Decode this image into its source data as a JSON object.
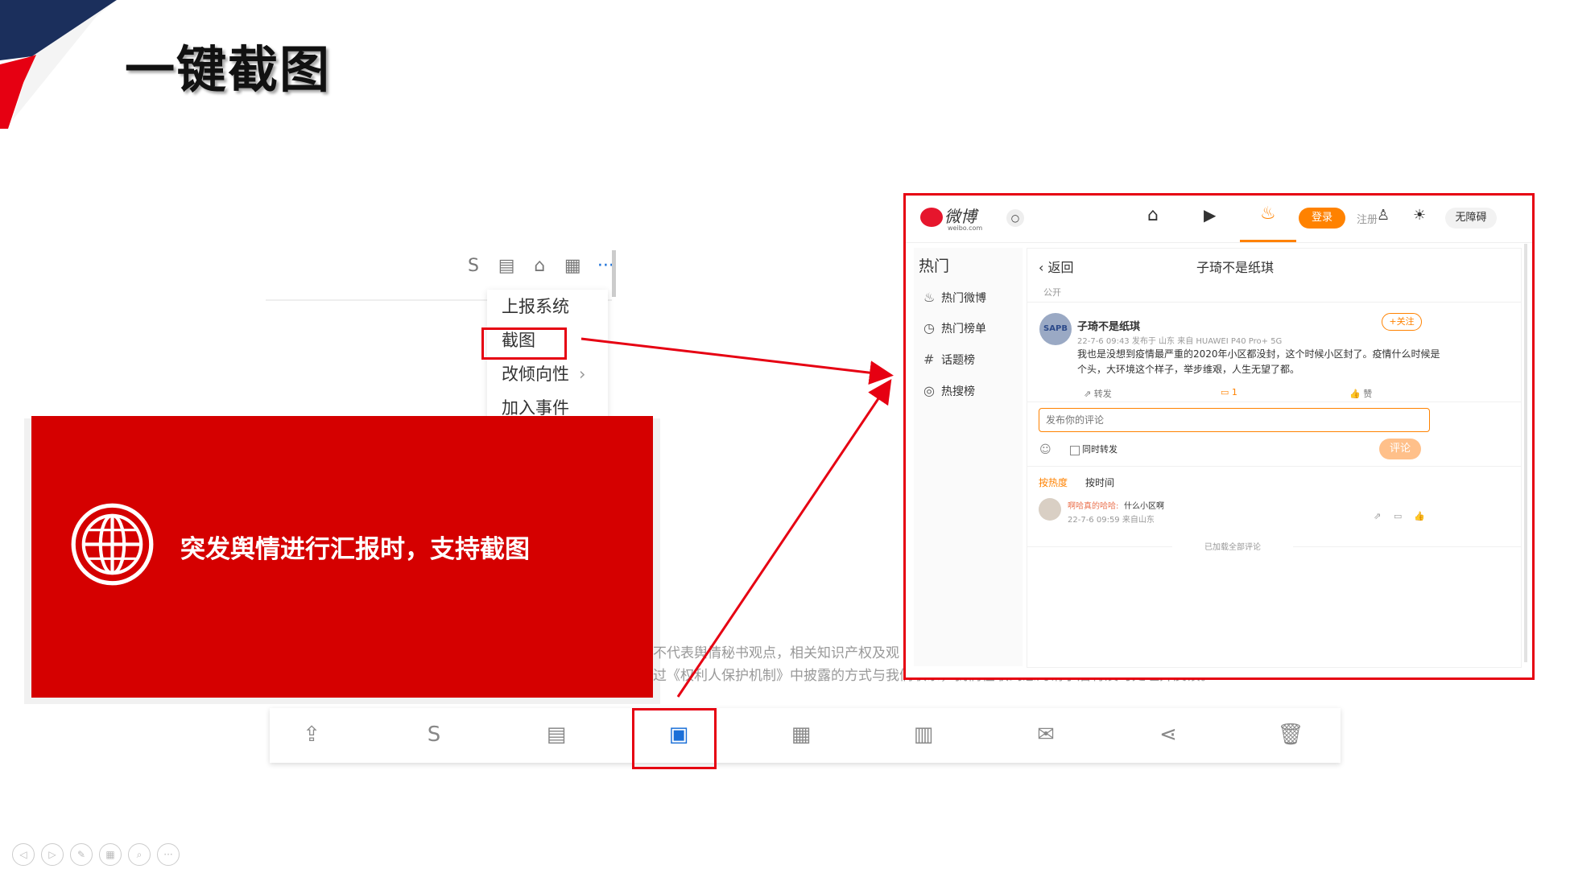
{
  "slide_title": "一键截图",
  "top_toolbar_icons": [
    "revoke-icon",
    "document-icon",
    "bank-icon",
    "report-add-icon",
    "more-icon"
  ],
  "context_menu": {
    "items": [
      "上报系统",
      "截图",
      "改倾向性",
      "加入事件"
    ],
    "submenu_arrow": "›"
  },
  "banner": {
    "text": "突发舆情进行汇报时，支持截图"
  },
  "faint_text": {
    "line1": "不代表舆情秘书观点，相关知识产权及观",
    "line2": "过《权利人保护机制》中披露的方式与我们联系，我们在收到您的请求后将及时处理并反馈。"
  },
  "bottom_toolbar_icons": [
    "upload-icon",
    "revoke-icon",
    "document-icon",
    "screenshot-icon",
    "report-add-icon",
    "report-locate-icon",
    "mail-icon",
    "share-icon",
    "delete-icon"
  ],
  "weibo": {
    "logo_text": "微博",
    "logo_sub": "weibo.com",
    "nav_icons": [
      "home-icon",
      "video-icon",
      "hot-icon"
    ],
    "login_label": "登录",
    "register_label": "注册",
    "accessibility_label": "无障碍",
    "sidebar": {
      "heading": "热门",
      "items": [
        {
          "icon": "flame-icon",
          "label": "热门微博"
        },
        {
          "icon": "clock-icon",
          "label": "热门榜单"
        },
        {
          "icon": "hash-icon",
          "label": "话题榜"
        },
        {
          "icon": "search-ring-icon",
          "label": "热搜榜"
        }
      ]
    },
    "main": {
      "back_label": "返回",
      "page_title": "子琦不是纸琪",
      "visibility": "公开",
      "post": {
        "avatar_text": "SAPB",
        "author": "子琦不是纸琪",
        "follow_label": "+关注",
        "meta": "22-7-6 09:43 发布于 山东 来自 HUAWEI P40 Pro+ 5G",
        "content_line1": "我也是没想到疫情最严重的2020年小区都没封，这个时候小区封了。疫情什么时候是",
        "content_line2": "个头，大环境这个样子，举步维艰，人生无望了都。",
        "repost_label": "转发",
        "comment_count": "1",
        "like_label": "赞"
      },
      "comment_placeholder": "发布你的评论",
      "sync_repost_label": "同时转发",
      "comment_button": "评论",
      "sort_tabs": [
        "按热度",
        "按时间"
      ],
      "comments": [
        {
          "user": "啊哈真的哈哈:",
          "text": "什么小区啊",
          "meta": "22-7-6 09:59 来自山东"
        }
      ],
      "footer": "已加载全部评论"
    }
  },
  "slideshow_controls": [
    "prev-icon",
    "next-icon",
    "pen-icon",
    "slides-icon",
    "zoom-icon",
    "more-icon"
  ],
  "colors": {
    "accent_red": "#e60012",
    "banner_red": "#d50000",
    "weibo_orange": "#ff8200"
  }
}
